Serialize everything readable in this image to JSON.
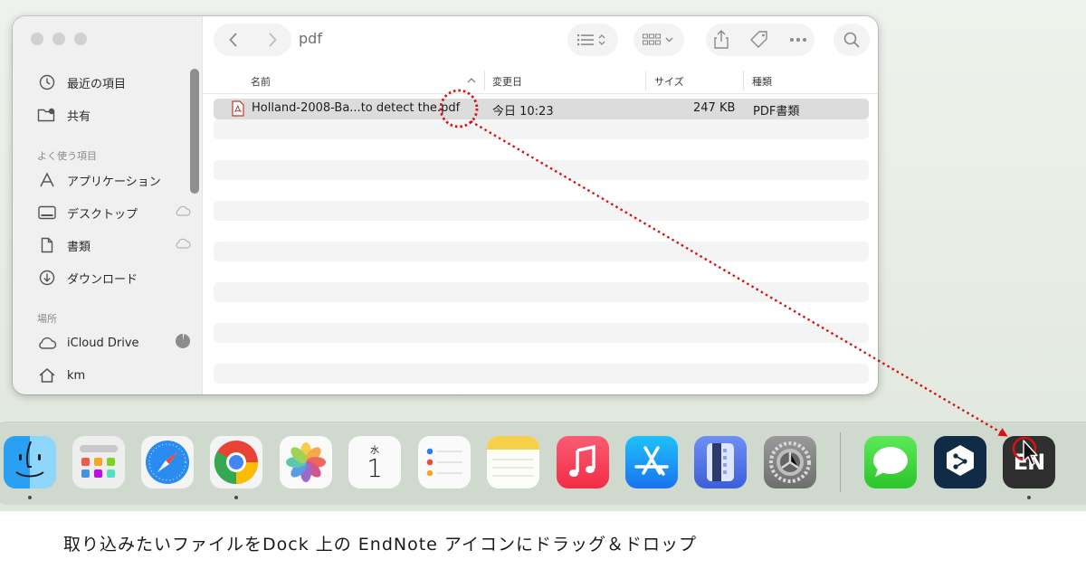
{
  "finder": {
    "title": "pdf",
    "sidebar": {
      "items_top": [
        {
          "label": "最近の項目",
          "icon": "clock-icon"
        },
        {
          "label": "共有",
          "icon": "shared-folder-icon"
        }
      ],
      "favorites_title": "よく使う項目",
      "favorites": [
        {
          "label": "アプリケーション",
          "icon": "applications-icon"
        },
        {
          "label": "デスクトップ",
          "icon": "desktop-icon"
        },
        {
          "label": "書類",
          "icon": "document-icon"
        },
        {
          "label": "ダウンロード",
          "icon": "download-icon"
        }
      ],
      "locations_title": "場所",
      "locations": [
        {
          "label": "iCloud Drive",
          "icon": "cloud-icon"
        },
        {
          "label": "km",
          "icon": "home-icon"
        }
      ]
    },
    "columns": {
      "name": "名前",
      "date": "変更日",
      "size": "サイズ",
      "kind": "種類"
    },
    "file": {
      "name": "Holland-2008-Ba...to detect the.pdf",
      "date": "今日 10:23",
      "size": "247 KB",
      "kind": "PDF書類",
      "icon": "pdf-file-icon"
    }
  },
  "dock": {
    "apps": [
      {
        "name": "finder",
        "icon": "finder-icon",
        "running": true
      },
      {
        "name": "launchpad",
        "icon": "launchpad-icon",
        "running": false
      },
      {
        "name": "safari",
        "icon": "safari-icon",
        "running": false
      },
      {
        "name": "chrome",
        "icon": "chrome-icon",
        "running": true
      },
      {
        "name": "photos",
        "icon": "photos-icon",
        "running": false
      },
      {
        "name": "calendar",
        "icon": "calendar-icon",
        "running": false
      },
      {
        "name": "reminders",
        "icon": "reminders-icon",
        "running": false
      },
      {
        "name": "notes",
        "icon": "notes-icon",
        "running": false
      },
      {
        "name": "music",
        "icon": "music-icon",
        "running": false
      },
      {
        "name": "app-store",
        "icon": "app-store-icon",
        "running": false
      },
      {
        "name": "simulator",
        "icon": "simulator-icon",
        "running": false
      },
      {
        "name": "system-settings",
        "icon": "gear-icon",
        "running": false
      },
      {
        "name": "messages",
        "icon": "messages-icon",
        "running": false
      },
      {
        "name": "deepl",
        "icon": "deepl-icon",
        "running": false
      },
      {
        "name": "endnote",
        "icon": "endnote-icon",
        "running": true
      }
    ],
    "calendar_weekday": "水",
    "calendar_day": "1",
    "endnote_label": "EN"
  },
  "caption": "取り込みたいファイルをDock 上の EndNote アイコンにドラッグ＆ドロップ",
  "colors": {
    "annotation": "#d41414",
    "selection": "#dcdcdc"
  }
}
